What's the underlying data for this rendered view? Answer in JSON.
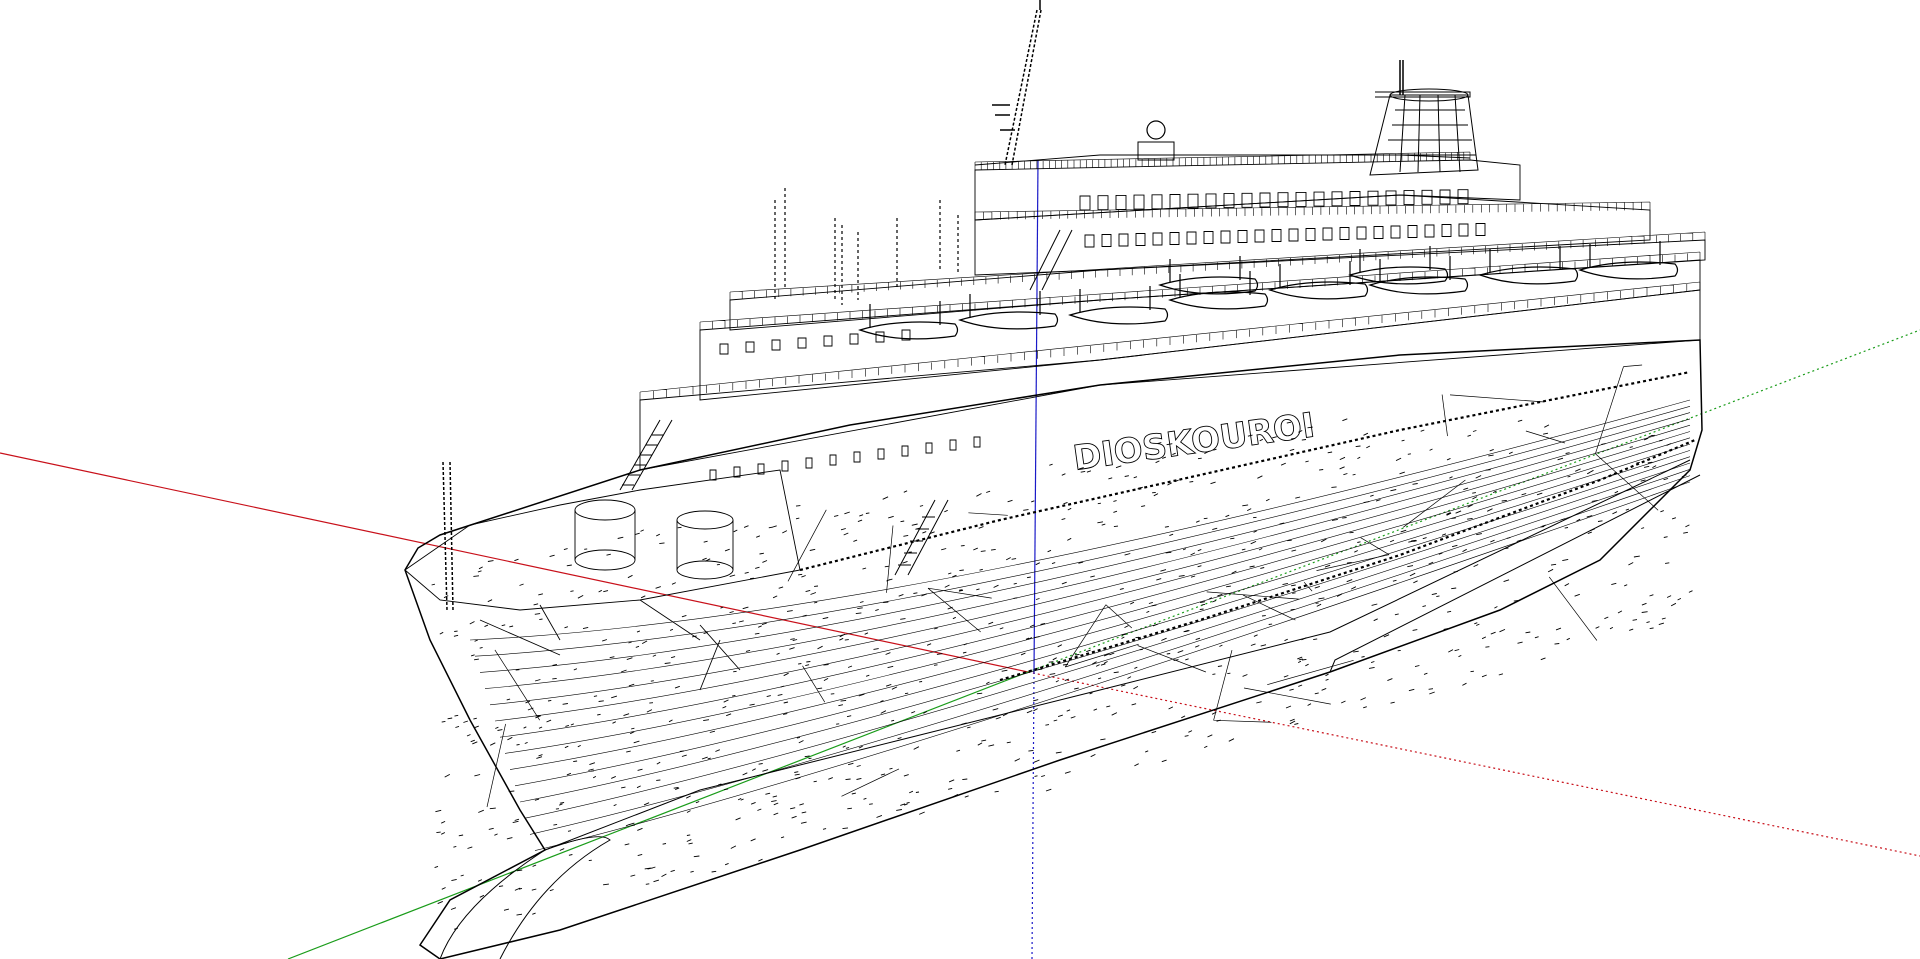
{
  "viewport": {
    "background": "#ffffff",
    "mode": "wireframe"
  },
  "axes": {
    "red": "#c8101a",
    "green": "#1a9c1a",
    "blue": "#1a1ac8"
  },
  "model": {
    "line_color": "#000000",
    "hull_lettering": "DIOSKOUROI"
  }
}
